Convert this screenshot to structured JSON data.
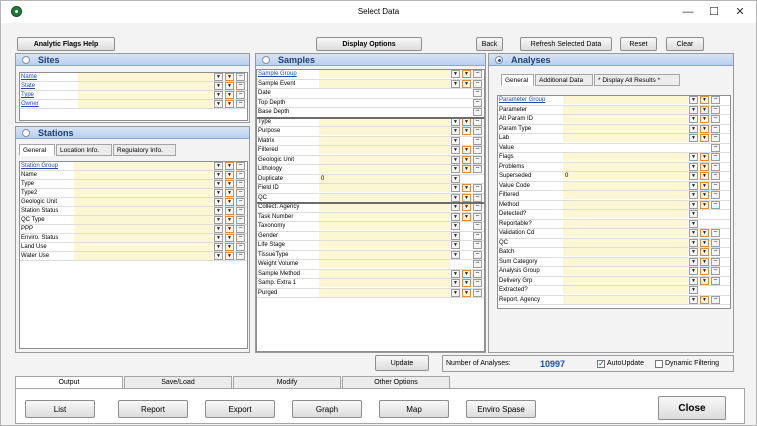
{
  "window": {
    "title": "Select Data",
    "minimize": "—",
    "maximize": "☐",
    "close": "✕"
  },
  "toolbar": {
    "analytic_flags_help": "Analytic Flags Help",
    "display_options": "Display Options",
    "back": "Back",
    "refresh_selected_data": "Refresh Selected Data",
    "reset": "Reset",
    "clear": "Clear"
  },
  "sites": {
    "header": "Sites",
    "rows": [
      "Name",
      "State",
      "Type",
      "Owner"
    ]
  },
  "stations": {
    "header": "Stations",
    "tabs": [
      "General",
      "Location Info.",
      "Regulatory Info."
    ],
    "rows": [
      {
        "label": "Station Group",
        "link": true
      },
      {
        "label": "Name"
      },
      {
        "label": "Type"
      },
      {
        "label": "Type2"
      },
      {
        "label": "Geologic Unit"
      },
      {
        "label": "Station Status"
      },
      {
        "label": "QC Type"
      },
      {
        "label": "PPP"
      },
      {
        "label": "Enviro. Status"
      },
      {
        "label": "Land Use"
      },
      {
        "label": "Water Use"
      }
    ]
  },
  "samples": {
    "header": "Samples",
    "rows": [
      {
        "label": "Sample Group",
        "link": true,
        "value": "",
        "dd": true,
        "or": true,
        "mi": true
      },
      {
        "label": "Sample Event",
        "value": "",
        "dd": true,
        "or": true,
        "mi": true
      },
      {
        "label": "Date",
        "value": "",
        "dd": false,
        "or": false,
        "mi": true,
        "plain": true
      },
      {
        "label": "Top Depth",
        "value": "",
        "dd": false,
        "or": false,
        "mi": true,
        "plain": true
      },
      {
        "label": "Base Depth",
        "value": "",
        "dd": false,
        "or": false,
        "mi": true,
        "plain": true
      },
      {
        "label": "Type",
        "value": "",
        "dd": true,
        "or": true,
        "mi": true
      },
      {
        "label": "Purpose",
        "value": "",
        "dd": true,
        "or": true,
        "mi": true
      },
      {
        "label": "Matrix",
        "value": "",
        "dd": true,
        "or": false,
        "mi": true
      },
      {
        "label": "Filtered",
        "value": "",
        "dd": true,
        "or": true,
        "mi": true
      },
      {
        "label": "Geologic Unit",
        "value": "",
        "dd": true,
        "or": true,
        "mi": true
      },
      {
        "label": "Lithology",
        "value": "",
        "dd": true,
        "or": true,
        "mi": true
      },
      {
        "label": "Duplicate",
        "value": "0",
        "dd": true,
        "or": false,
        "mi": false
      },
      {
        "label": "Field ID",
        "value": "",
        "dd": true,
        "or": true,
        "mi": true
      },
      {
        "label": "QC",
        "value": "",
        "dd": true,
        "or": true,
        "mi": true
      },
      {
        "label": "Collect. Agency",
        "value": "",
        "dd": true,
        "or": true,
        "mi": true
      },
      {
        "label": "Task Number",
        "value": "",
        "dd": true,
        "or": true,
        "mi": true
      },
      {
        "label": "Taxonomy",
        "value": "",
        "dd": true,
        "or": false,
        "mi": true
      },
      {
        "label": "Gender",
        "value": "",
        "dd": true,
        "or": false,
        "mi": true
      },
      {
        "label": "Life Stage",
        "value": "",
        "dd": true,
        "or": false,
        "mi": true
      },
      {
        "label": "TissueType",
        "value": "",
        "dd": true,
        "or": false,
        "mi": true
      },
      {
        "label": "Weight Volume",
        "value": "",
        "dd": false,
        "or": false,
        "mi": true
      },
      {
        "label": "Sample Method",
        "value": "",
        "dd": true,
        "or": true,
        "mi": true
      },
      {
        "label": "Samp. Extra 1",
        "value": "",
        "dd": true,
        "or": true,
        "mi": true
      },
      {
        "label": "Purged",
        "value": "",
        "dd": true,
        "or": true,
        "mi": true
      }
    ]
  },
  "analyses": {
    "header": "Analyses",
    "tabs": [
      "General",
      "Additional Data",
      "* Display All Results *"
    ],
    "rows": [
      {
        "label": "Parameter Group",
        "link": true,
        "value": "",
        "dd": true,
        "or": true,
        "mi": true
      },
      {
        "label": "Parameter",
        "value": "",
        "dd": true,
        "or": true,
        "mi": true
      },
      {
        "label": "Alt Param ID",
        "value": "",
        "dd": true,
        "or": true,
        "mi": true
      },
      {
        "label": "Param Type",
        "value": "",
        "dd": true,
        "or": true,
        "mi": true
      },
      {
        "label": "Lab",
        "value": "",
        "dd": true,
        "or": true,
        "mi": true
      },
      {
        "label": "Value",
        "value": "",
        "dd": false,
        "or": false,
        "mi": true,
        "plain": true
      },
      {
        "label": "Flags",
        "value": "",
        "dd": true,
        "or": true,
        "mi": true
      },
      {
        "label": "Problems",
        "value": "",
        "dd": true,
        "or": true,
        "mi": true
      },
      {
        "label": "Superseded",
        "value": "0",
        "dd": true,
        "or": true,
        "mi": true
      },
      {
        "label": "Value Code",
        "value": "",
        "dd": true,
        "or": true,
        "mi": true
      },
      {
        "label": "Filtered",
        "value": "",
        "dd": true,
        "or": true,
        "mi": true
      },
      {
        "label": "Method",
        "value": "",
        "dd": true,
        "or": true,
        "mi": true
      },
      {
        "label": "Detected?",
        "value": "",
        "dd": true,
        "or": false,
        "mi": false
      },
      {
        "label": "Reportable?",
        "value": "",
        "dd": true,
        "or": false,
        "mi": false
      },
      {
        "label": "Validation Cd",
        "value": "",
        "dd": true,
        "or": true,
        "mi": true
      },
      {
        "label": "QC",
        "value": "",
        "dd": true,
        "or": true,
        "mi": true
      },
      {
        "label": "Batch",
        "value": "",
        "dd": true,
        "or": true,
        "mi": true
      },
      {
        "label": "Sum Category",
        "value": "",
        "dd": true,
        "or": true,
        "mi": true
      },
      {
        "label": "Analysis Group",
        "value": "",
        "dd": true,
        "or": true,
        "mi": true
      },
      {
        "label": "Delivery Grp",
        "value": "",
        "dd": true,
        "or": true,
        "mi": true
      },
      {
        "label": "Extracted?",
        "value": "",
        "dd": true,
        "or": false,
        "mi": false
      },
      {
        "label": "Report. Agency",
        "value": "",
        "dd": true,
        "or": true,
        "mi": true
      }
    ]
  },
  "status": {
    "update": "Update",
    "num_analyses_label": "Number of Analyses:",
    "num_analyses": "10997",
    "autoupdate": "AutoUpdate",
    "autoupdate_checked": true,
    "dynamic_filtering": "Dynamic Filtering",
    "dynamic_filtering_checked": false
  },
  "bottom_tabs": [
    "Output",
    "Save/Load",
    "Modify",
    "Other Options"
  ],
  "output_buttons": [
    "List",
    "Report",
    "Export",
    "Graph",
    "Map",
    "Enviro Spase"
  ],
  "close_button": "Close",
  "colors": {
    "accent": "#1d3f73",
    "field": "#fbf7d2",
    "orange": "#e08a3a",
    "count": "#1c4ea3"
  }
}
